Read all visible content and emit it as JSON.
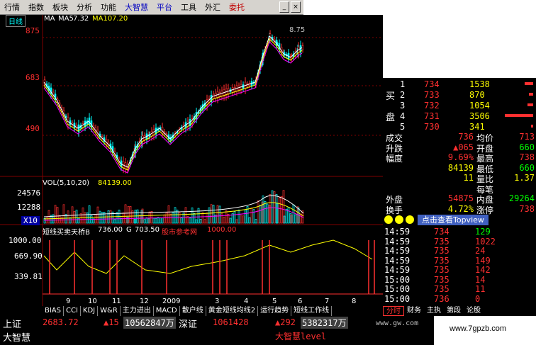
{
  "menu": {
    "items": [
      "行情",
      "指数",
      "板块",
      "分析",
      "功能",
      "大智慧",
      "平台",
      "工具",
      "外汇",
      "委托"
    ],
    "colors": [
      "#000000",
      "#000000",
      "#000000",
      "#000000",
      "#000000",
      "#0000c0",
      "#0000c0",
      "#000000",
      "#000000",
      "#c00000"
    ]
  },
  "window_buttons": {
    "minimize": "_",
    "close": "×"
  },
  "main_chart": {
    "period_tab": "日线",
    "ma_label": "MA",
    "ma5_label": "MA5",
    "ma5_value": "7.32",
    "ma10_label": "MA10",
    "ma10_value": "7.20",
    "high_label": "8.75",
    "y_ticks": [
      "875",
      "683",
      "490"
    ]
  },
  "volume_chart": {
    "label": "VOL(5,10,20)",
    "value": "84139.00",
    "y_ticks": [
      "24576",
      "12288",
      "X10"
    ]
  },
  "indicator_chart": {
    "name": "短线买卖天桥B",
    "v1": "736.00",
    "g_label": "G",
    "v2": "703.50",
    "ref_label": "股市参考网",
    "v3": "1000.00",
    "y_ticks": [
      "1000.00",
      "669.90",
      "339.81"
    ],
    "x_labels": [
      "9",
      "10",
      "11",
      "12",
      "2009",
      "3",
      "4",
      "5",
      "6",
      "7",
      "8"
    ]
  },
  "bottom_tabs": [
    "BIAS",
    "CCI",
    "KDJ",
    "W&R",
    "主力进出",
    "MACD",
    "散户线",
    "黄金短线均线2",
    "运行趋势",
    "短线工作线"
  ],
  "quote_panel": {
    "buy_label": "买",
    "buy_label2": "盘",
    "bids": [
      {
        "level": "1",
        "price": "734",
        "vol": "1538"
      },
      {
        "level": "2",
        "price": "733",
        "vol": "870"
      },
      {
        "level": "3",
        "price": "732",
        "vol": "1054"
      },
      {
        "level": "4",
        "price": "731",
        "vol": "3506"
      },
      {
        "level": "5",
        "price": "730",
        "vol": "341"
      }
    ],
    "stats": [
      {
        "l1": "成交",
        "v1": "736",
        "l2": "均价",
        "v2": "713"
      },
      {
        "l1": "升跌",
        "v1": "▲065",
        "l2": "开盘",
        "v2": "660"
      },
      {
        "l1": "幅度",
        "v1": "9.69%",
        "l2": "最高",
        "v2": "738"
      },
      {
        "l1": "",
        "v1": "84139",
        "l2": "最低",
        "v2": "660"
      },
      {
        "l1": "",
        "v1": "11",
        "l2": "量比",
        "v2": "1.37"
      },
      {
        "l1": "",
        "v1": "",
        "l2": "每笔",
        "v2": ""
      },
      {
        "l1": "外盘",
        "v1": "54875",
        "l2": "内盘",
        "v2": "29264"
      },
      {
        "l1": "换手",
        "v1": "4.72%",
        "l2": "涨停",
        "v2": "738"
      }
    ],
    "topview_label": "点击查看Topview",
    "ticks": [
      {
        "time": "14:59",
        "price": "734",
        "vol": "129"
      },
      {
        "time": "14:59",
        "price": "735",
        "vol": "1022"
      },
      {
        "time": "14:59",
        "price": "735",
        "vol": "24"
      },
      {
        "time": "14:59",
        "price": "735",
        "vol": "149"
      },
      {
        "time": "14:59",
        "price": "735",
        "vol": "142"
      },
      {
        "time": "15:00",
        "price": "735",
        "vol": "14"
      },
      {
        "time": "15:00",
        "price": "735",
        "vol": "11"
      },
      {
        "time": "15:00",
        "price": "736",
        "vol": "0"
      }
    ],
    "tabs": [
      "分时",
      "财务",
      "主执",
      "第段",
      "论股"
    ]
  },
  "status_bar": {
    "sh_label": "上证",
    "sh_value": "2683.72",
    "sh_change": "▲15",
    "sh_amount": "10562847万",
    "sz_label": "深证",
    "sz_value": "1061428",
    "sz_change": "▲292",
    "sz_amount": "5382317万",
    "brand": "大智慧",
    "brand2": "大智慧level",
    "site": "www.gw.com"
  },
  "watermark": "www.7gpzb.com",
  "colors": {
    "up": "#ff3030",
    "down": "#00ffff",
    "ma5": "#ffffff",
    "ma10": "#ffff00",
    "ma20": "#ff00ff",
    "grid": "#800000"
  }
}
